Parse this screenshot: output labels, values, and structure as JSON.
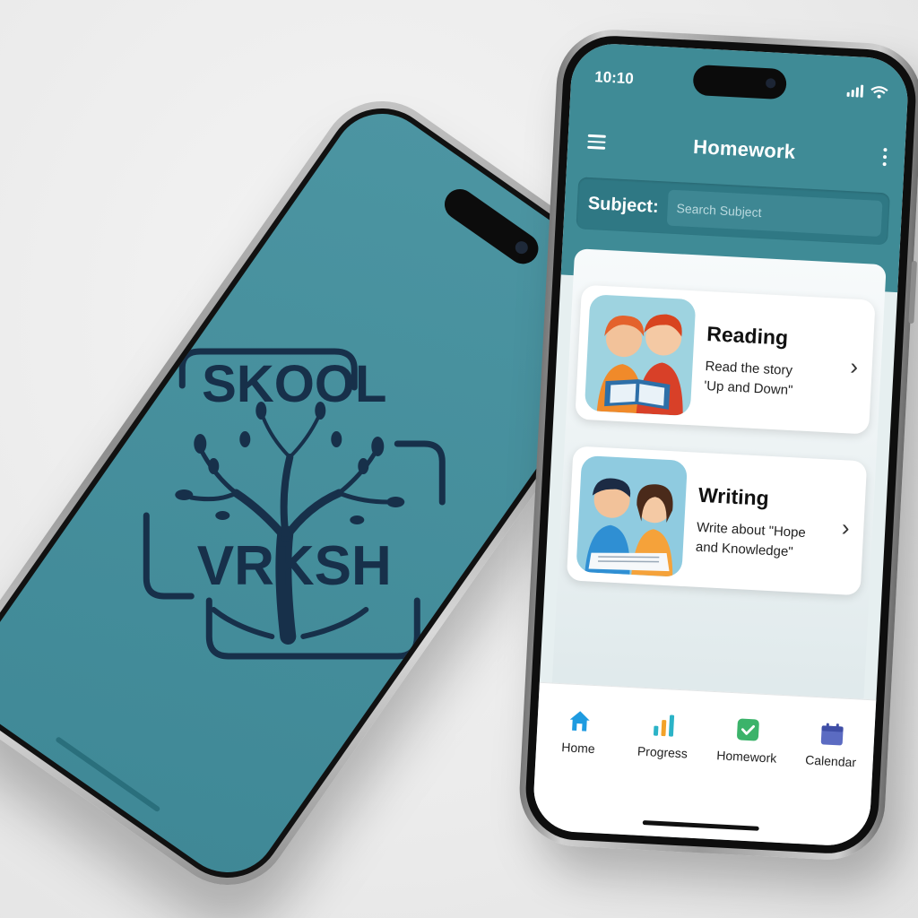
{
  "splash": {
    "logo_word_top": "SKOOL",
    "logo_word_bottom": "VRKSH",
    "background": "#4690a0",
    "logo_color": "#17304a"
  },
  "status_bar": {
    "time": "10:10"
  },
  "header": {
    "title": "Homework"
  },
  "subject_search": {
    "label": "Subject:",
    "placeholder": "Search Subject"
  },
  "homework": [
    {
      "title": "Reading",
      "description_line1": "Read the story",
      "description_line2": "'Up and Down\"",
      "icon": "children-reading-book-illustration"
    },
    {
      "title": "Writing",
      "description_line1": "Write about \"Hope",
      "description_line2": "and Knowledge\"",
      "icon": "children-writing-illustration"
    }
  ],
  "tabs": [
    {
      "label": "Home",
      "icon": "home-icon",
      "color": "#1e9be0"
    },
    {
      "label": "Progress",
      "icon": "bar-chart-icon",
      "color": "#2bb3c7"
    },
    {
      "label": "Homework",
      "icon": "checkmark-icon",
      "color": "#3bb36a"
    },
    {
      "label": "Calendar",
      "icon": "calendar-icon",
      "color": "#5b6bc2"
    }
  ],
  "colors": {
    "accent": "#3f8b96",
    "accent_dark": "#2f7884"
  }
}
